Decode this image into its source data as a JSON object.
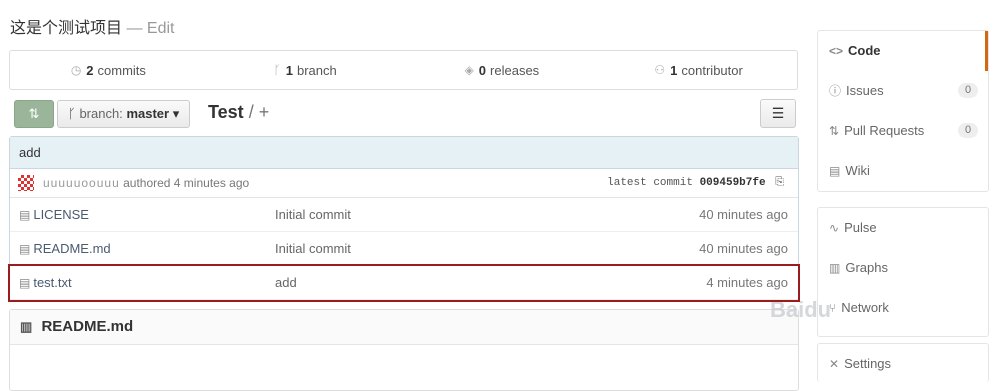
{
  "repo": {
    "description": "这是个测试项目",
    "edit_label": "— Edit"
  },
  "stats": [
    {
      "count": "2",
      "label": "commits",
      "icon": "history-icon"
    },
    {
      "count": "1",
      "label": "branch",
      "icon": "branch-icon"
    },
    {
      "count": "0",
      "label": "releases",
      "icon": "tag-icon"
    },
    {
      "count": "1",
      "label": "contributor",
      "icon": "organization-icon"
    }
  ],
  "toolbar": {
    "branch_prefix": "branch:",
    "branch_name": "master",
    "repo_name": "Test",
    "path_sep": "/",
    "new_file": "+"
  },
  "commit": {
    "message": "add",
    "author": "uuuuuoouuu",
    "authored": "authored 4 minutes ago",
    "latest_label": "latest commit",
    "sha": "009459b7fe"
  },
  "files": [
    {
      "name": "LICENSE",
      "message": "Initial commit",
      "age": "40 minutes ago"
    },
    {
      "name": "README.md",
      "message": "Initial commit",
      "age": "40 minutes ago"
    },
    {
      "name": "test.txt",
      "message": "add",
      "age": "4 minutes ago"
    }
  ],
  "readme": {
    "title": "README.md"
  },
  "sidebar": {
    "items": [
      {
        "label": "Code",
        "icon": "code-icon",
        "glyph": "<>",
        "active": true
      },
      {
        "label": "Issues",
        "icon": "issue-icon",
        "glyph": "ⓘ",
        "count": "0"
      },
      {
        "label": "Pull Requests",
        "icon": "pull-request-icon",
        "glyph": "⇅",
        "count": "0"
      },
      {
        "label": "Wiki",
        "icon": "wiki-icon",
        "glyph": "▤"
      },
      {
        "label": "Pulse",
        "icon": "pulse-icon",
        "glyph": "∿"
      },
      {
        "label": "Graphs",
        "icon": "graph-icon",
        "glyph": "▥"
      },
      {
        "label": "Network",
        "icon": "network-icon",
        "glyph": "⑂"
      },
      {
        "label": "Settings",
        "icon": "settings-icon",
        "glyph": "✕"
      }
    ]
  },
  "watermark": "Baidu"
}
